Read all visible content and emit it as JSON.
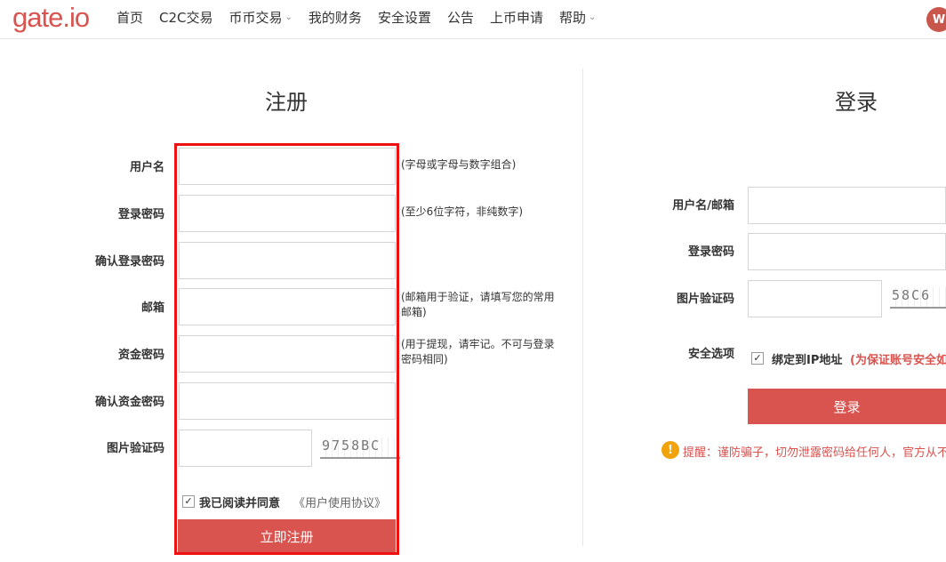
{
  "header": {
    "logo": "gate.io",
    "nav": [
      {
        "label": "首页",
        "chevron": false
      },
      {
        "label": "C2C交易",
        "chevron": false
      },
      {
        "label": "币币交易",
        "chevron": true
      },
      {
        "label": "我的财务",
        "chevron": false
      },
      {
        "label": "安全设置",
        "chevron": false
      },
      {
        "label": "公告",
        "chevron": false
      },
      {
        "label": "上币申请",
        "chevron": false
      },
      {
        "label": "帮助",
        "chevron": true
      }
    ]
  },
  "register": {
    "title": "注册",
    "fields": {
      "username": {
        "label": "用户名",
        "hint": "(字母或字母与数字组合)"
      },
      "password": {
        "label": "登录密码",
        "hint": "(至少6位字符，非纯数字)"
      },
      "confirm_password": {
        "label": "确认登录密码",
        "hint": ""
      },
      "email": {
        "label": "邮箱",
        "hint": "(邮箱用于验证，请填写您的常用邮箱)"
      },
      "fund_password": {
        "label": "资金密码",
        "hint": "(用于提现，请牢记。不可与登录密码相同)"
      },
      "confirm_fund_password": {
        "label": "确认资金密码",
        "hint": ""
      },
      "captcha": {
        "label": "图片验证码",
        "image_text": "9758BC"
      }
    },
    "agree_text": "我已阅读并同意",
    "agreement_link": "《用户使用协议》",
    "submit": "立即注册"
  },
  "login": {
    "title": "登录",
    "fields": {
      "account": {
        "label": "用户名/邮箱"
      },
      "password": {
        "label": "登录密码"
      },
      "captcha": {
        "label": "图片验证码",
        "image_text": "58C6"
      }
    },
    "security": {
      "label": "安全选项",
      "bind_ip": "绑定到IP地址",
      "note": "(为保证账号安全如"
    },
    "submit": "登录",
    "warning": "提醒：谨防骗子，切勿泄露密码给任何人，官方从不"
  },
  "colors": {
    "brand": "#d9534f",
    "highlight_frame": "#ee1111",
    "warning": "#f0a30a"
  }
}
